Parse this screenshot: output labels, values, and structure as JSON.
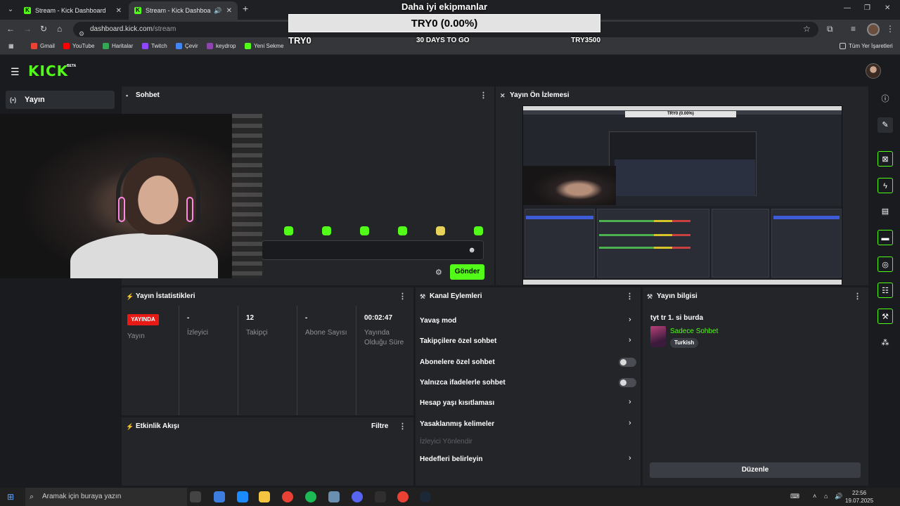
{
  "browser": {
    "tabs": [
      {
        "title": "Stream - Kick Dashboard",
        "active": false
      },
      {
        "title": "Stream - Kick Dashboard",
        "active": true
      }
    ],
    "url_domain": "dashboard.kick.com",
    "url_path": "/stream",
    "bookmarks": [
      {
        "label": "Gmail",
        "color": "#ea4335"
      },
      {
        "label": "YouTube",
        "color": "#ff0000"
      },
      {
        "label": "Haritalar",
        "color": "#34a853"
      },
      {
        "label": "Twitch",
        "color": "#9146ff"
      },
      {
        "label": "Çevir",
        "color": "#4285f4"
      },
      {
        "label": "keydrop",
        "color": "#8e44ad"
      },
      {
        "label": "Yeni Sekme",
        "color": "#53fc18"
      }
    ],
    "all_bookmarks": "Tüm Yer İşaretleri"
  },
  "overlay": {
    "title": "Daha iyi ekipmanlar",
    "progress_text": "TRY0 (0.00%)",
    "progress": 0.0,
    "min": "TRY0",
    "days_left": "30 DAYS TO GO",
    "max": "TRY3500"
  },
  "kick": {
    "logo": "KICK",
    "beta": "BETA",
    "accent": "#53fc18",
    "sidebar": {
      "item": "Yayın"
    }
  },
  "chat": {
    "title": "Sohbet",
    "send": "Gönder"
  },
  "preview": {
    "title": "Yayın Ön İzlemesi",
    "goal_text": "TRY0 (0.00%)"
  },
  "stats": {
    "title": "Yayın İstatistikleri",
    "live_badge": "YAYINDA",
    "cells": [
      {
        "value": "",
        "label": "Yayın"
      },
      {
        "value": "-",
        "label": "İzleyici"
      },
      {
        "value": "12",
        "label": "Takipçi"
      },
      {
        "value": "-",
        "label": "Abone Sayısı"
      },
      {
        "value": "00:02:47",
        "label": "Yayında Olduğu Süre"
      }
    ]
  },
  "actions": {
    "title": "Kanal Eylemleri",
    "items": [
      {
        "label": "Yavaş mod",
        "control": "chevron"
      },
      {
        "label": "Takipçilere özel sohbet",
        "control": "chevron"
      },
      {
        "label": "Abonelere özel sohbet",
        "control": "toggle",
        "on": false
      },
      {
        "label": "Yalnızca ifadelerle sohbet",
        "control": "toggle",
        "on": false
      },
      {
        "label": "Hesap yaşı kısıtlaması",
        "control": "chevron"
      },
      {
        "label": "Yasaklanmış kelimeler",
        "control": "chevron"
      },
      {
        "label": "İzleyici Yönlendir",
        "control": "none"
      },
      {
        "label": "Hedefleri belirleyin",
        "control": "chevron"
      }
    ]
  },
  "info": {
    "title": "Yayın bilgisi",
    "stream_title": "tyt tr 1. si burda",
    "category": "Sadece Sohbet",
    "language": "Turkish",
    "edit": "Düzenle"
  },
  "activity": {
    "title": "Etkinlik Akışı",
    "filter": "Filtre"
  },
  "taskbar": {
    "search": "Aramak için buraya yazın",
    "time": "22:56",
    "date": "19.07.2025"
  }
}
